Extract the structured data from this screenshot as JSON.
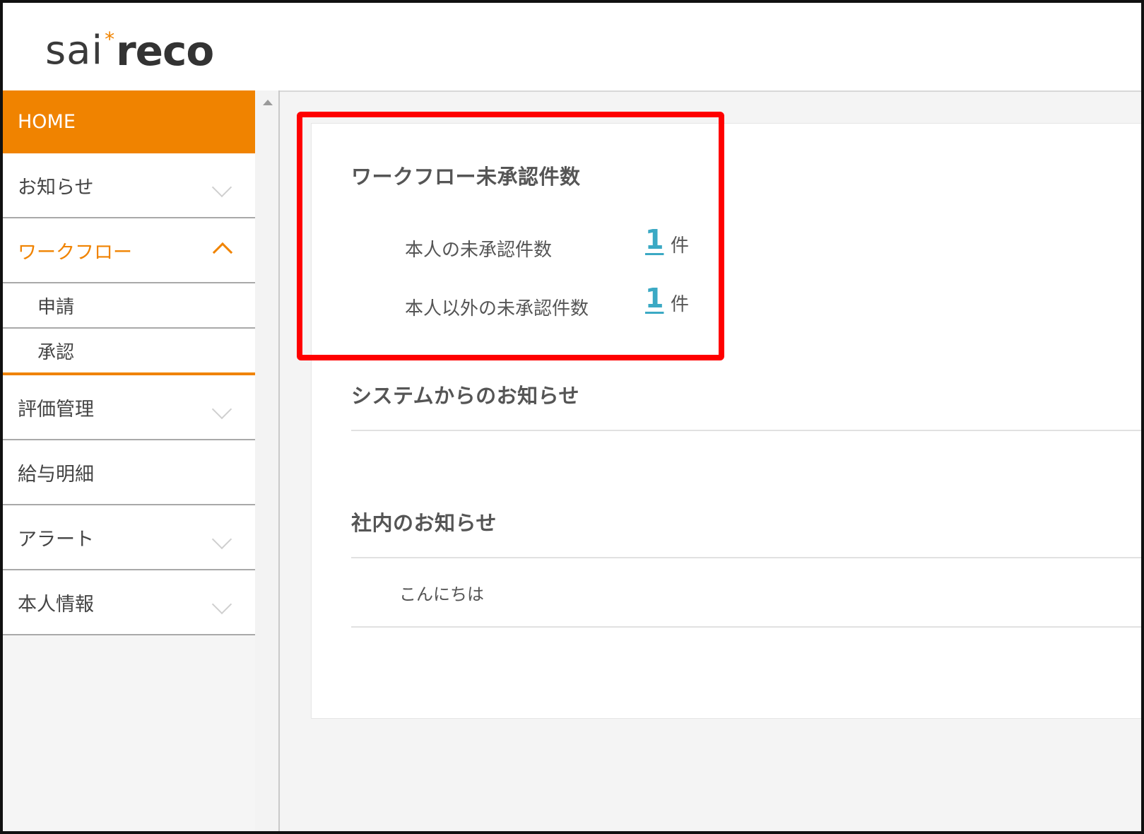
{
  "header": {
    "logo": {
      "part1": "sai",
      "star": "*",
      "part2": "reco"
    }
  },
  "sidebar": {
    "home_label": "HOME",
    "items": [
      {
        "label": "お知らせ"
      },
      {
        "label": "ワークフロー"
      },
      {
        "label": "評価管理"
      },
      {
        "label": "給与明細"
      },
      {
        "label": "アラート"
      },
      {
        "label": "本人情報"
      }
    ],
    "workflow_sub": [
      {
        "label": "申請"
      },
      {
        "label": "承認"
      }
    ]
  },
  "workflow_pending": {
    "title": "ワークフロー未承認件数",
    "rows": [
      {
        "label": "本人の未承認件数",
        "count": "1",
        "unit": "件"
      },
      {
        "label": "本人以外の未承認件数",
        "count": "1",
        "unit": "件"
      }
    ]
  },
  "system_notices": {
    "title": "システムからのお知らせ"
  },
  "company_notices": {
    "title": "社内のお知らせ",
    "items": [
      {
        "text": "こんにちは"
      }
    ]
  },
  "colors": {
    "accent": "#f08300",
    "link": "#3ba9c4",
    "highlight": "#ff0000"
  }
}
